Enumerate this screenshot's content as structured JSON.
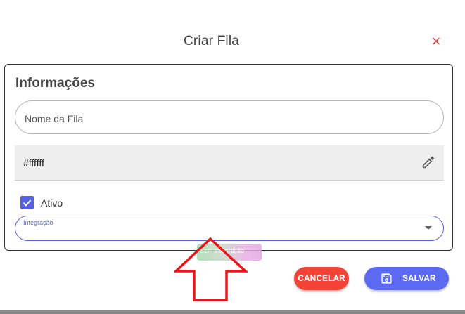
{
  "dialog": {
    "title": "Criar Fila",
    "close_icon": "×"
  },
  "section": {
    "title": "Informações"
  },
  "fields": {
    "name": {
      "placeholder": "Nome da Fila",
      "value": ""
    },
    "color": {
      "value": "#ffffff"
    },
    "active": {
      "label": "Ativo",
      "checked": true
    },
    "integration": {
      "label": "Integração",
      "value": ""
    }
  },
  "tag_chip": {
    "label": "Sem integração"
  },
  "buttons": {
    "cancel": "CANCELAR",
    "save": "SALVAR"
  },
  "colors": {
    "accent": "#5663e0",
    "cancel": "#f24336",
    "save": "#5b6af0",
    "close": "#e53935",
    "annotation_arrow": "#e8161b"
  }
}
